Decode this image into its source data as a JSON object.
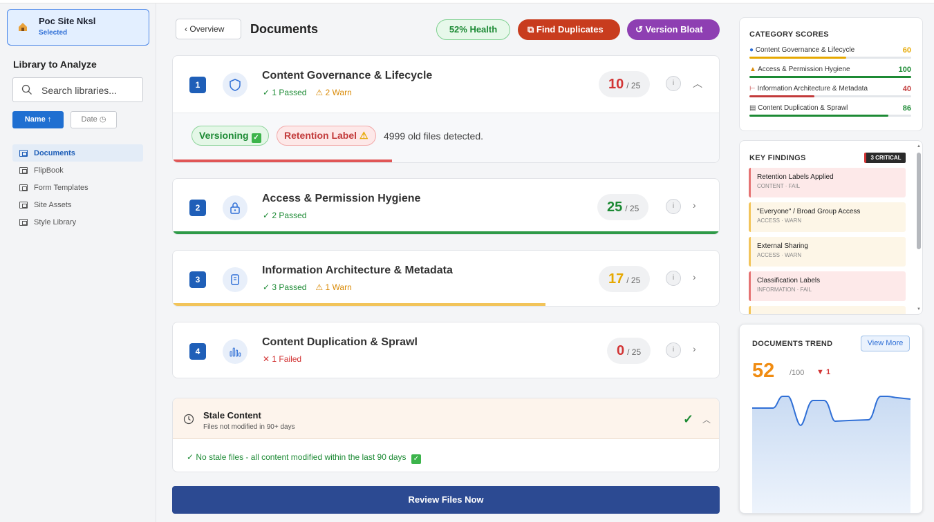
{
  "sidebar": {
    "site_name": "Poc Site Nksl",
    "site_status": "Selected",
    "heading": "Library to Analyze",
    "search_placeholder": "Search libraries...",
    "sort_name": "Name ↑",
    "sort_date": "Date",
    "libraries": [
      "Documents",
      "FlipBook",
      "Form Templates",
      "Site Assets",
      "Style Library"
    ],
    "active_library": "Documents"
  },
  "header": {
    "back_label": "Overview",
    "title": "Documents",
    "health": "52% Health",
    "find_duplicates": "Find Duplicates",
    "version_bloat": "Version Bloat"
  },
  "categories": [
    {
      "num": "1",
      "title": "Content Governance & Lifecycle",
      "passed": "✓ 1 Passed",
      "warn": "⚠ 2 Warn",
      "failed": "",
      "score": "10",
      "max": "/ 25",
      "score_color": "#d23434",
      "bar_color": "#e05656",
      "progress": 0.4,
      "icon": "shield-icon",
      "expanded": true
    },
    {
      "num": "2",
      "title": "Access & Permission Hygiene",
      "passed": "✓ 2 Passed",
      "warn": "",
      "failed": "",
      "score": "25",
      "max": "/ 25",
      "score_color": "#1c8a34",
      "bar_color": "#2e9a48",
      "progress": 1.0,
      "icon": "lock-icon",
      "expanded": false
    },
    {
      "num": "3",
      "title": "Information Architecture & Metadata",
      "passed": "✓ 3 Passed",
      "warn": "⚠ 1 Warn",
      "failed": "",
      "score": "17",
      "max": "/ 25",
      "score_color": "#e6a800",
      "bar_color": "#f2c45a",
      "progress": 0.68,
      "icon": "file-icon",
      "expanded": false
    },
    {
      "num": "4",
      "title": "Content Duplication & Sprawl",
      "passed": "",
      "warn": "",
      "failed": "✕ 1 Failed",
      "score": "0",
      "max": "/ 25",
      "score_color": "#d23434",
      "bar_color": "#d23434",
      "progress": 0.0,
      "icon": "bar-chart-icon",
      "expanded": false
    }
  ],
  "expanded_detail": {
    "tag_versioning": "Versioning",
    "tag_retention": "Retention Label",
    "old_files": "4999 old files detected."
  },
  "stale": {
    "title": "Stale Content",
    "subtitle": "Files not modified in 90+ days",
    "message": "✓ No stale files - all content modified within the last 90 days"
  },
  "review_button": "Review Files Now",
  "category_scores": {
    "heading": "CATEGORY SCORES",
    "items": [
      {
        "label": "Content Governance & Lifecycle",
        "value": "60",
        "color": "#e6a800",
        "level": 0.6
      },
      {
        "label": "Access & Permission Hygiene",
        "value": "100",
        "color": "#1c8a34",
        "level": 1.0
      },
      {
        "label": "Information Architecture & Metadata",
        "value": "40",
        "color": "#c23a3a",
        "level": 0.4
      },
      {
        "label": "Content Duplication & Sprawl",
        "value": "86",
        "color": "#1c8a34",
        "level": 0.86
      }
    ]
  },
  "key_findings": {
    "heading": "KEY FINDINGS",
    "badge": "3 CRITICAL",
    "items": [
      {
        "title": "Retention Labels Applied",
        "sub": "CONTENT · FAIL",
        "severity": "fail"
      },
      {
        "title": "\"Everyone\" / Broad Group Access",
        "sub": "ACCESS · WARN",
        "severity": "warn"
      },
      {
        "title": "External Sharing",
        "sub": "ACCESS · WARN",
        "severity": "warn"
      },
      {
        "title": "Classification Labels",
        "sub": "INFORMATION · FAIL",
        "severity": "fail"
      }
    ]
  },
  "trend": {
    "heading": "DOCUMENTS TREND",
    "view_more": "View More",
    "value": "52",
    "max": "/100",
    "delta": "▼ 1"
  }
}
